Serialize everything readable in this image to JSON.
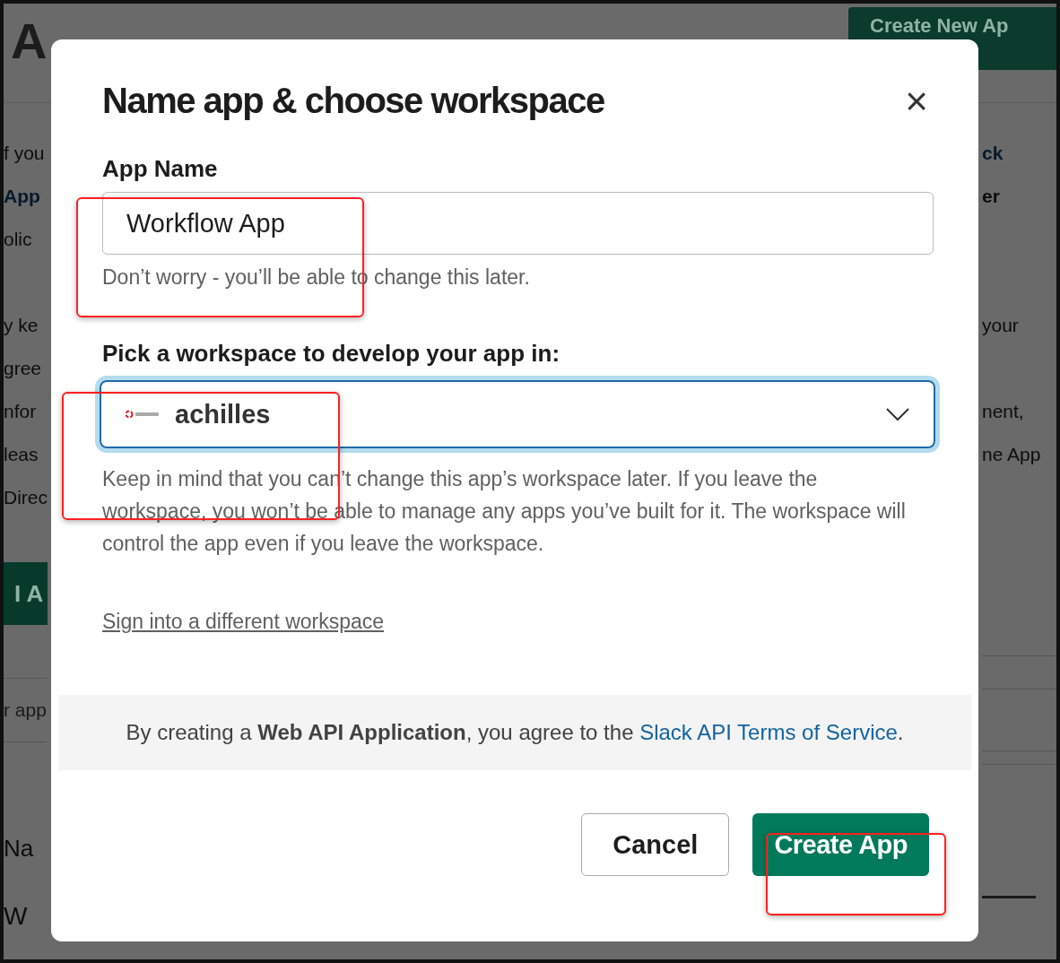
{
  "background": {
    "heading": "A",
    "create_button": "Create New Ap",
    "left_lines": [
      {
        "text": "f you",
        "kind": "plain"
      },
      {
        "text": "App",
        "kind": "link"
      },
      {
        "text": "olic",
        "kind": "plain"
      },
      {
        "kind": "blank"
      },
      {
        "text": "y ke",
        "kind": "plain"
      },
      {
        "text": "gree",
        "kind": "plain"
      },
      {
        "text": "nfor",
        "kind": "plain"
      },
      {
        "text": "leas",
        "kind": "plain"
      },
      {
        "text": "Direc",
        "kind": "plain"
      }
    ],
    "right_lines": [
      {
        "text": "ck",
        "kind": "link"
      },
      {
        "text": "er",
        "kind": "bold"
      },
      {
        "kind": "blank"
      },
      {
        "kind": "blank"
      },
      {
        "text": "your",
        "kind": "plain"
      },
      {
        "kind": "blank"
      },
      {
        "text": "nent,",
        "kind": "plain"
      },
      {
        "text": "ne App",
        "kind": "plain"
      },
      {
        "kind": "blank"
      }
    ],
    "agree_button": "I A",
    "search_placeholder": "r app",
    "column_header": "Na",
    "row_name": "W"
  },
  "dialog": {
    "title": "Name app & choose workspace",
    "close": "×",
    "app_name": {
      "label": "App Name",
      "value": "Workflow App",
      "hint": "Don’t worry - you’ll be able to change this later."
    },
    "workspace": {
      "label": "Pick a workspace to develop your app in:",
      "value": "achilles",
      "focused": true,
      "help": "Keep in mind that you can’t change this app’s workspace later. If you leave the workspace, you won’t be able to manage any apps you’ve built for it. The workspace will control the app even if you leave the workspace."
    },
    "sign_in_link": "Sign into a different workspace",
    "terms": {
      "before": "By creating a ",
      "bold": "Web API Application",
      "middle": ", you agree to the ",
      "link": "Slack API Terms of Service",
      "after": "."
    },
    "buttons": [
      {
        "label": "Cancel",
        "kind": "secondary"
      },
      {
        "label": "Create App",
        "kind": "primary"
      }
    ]
  }
}
